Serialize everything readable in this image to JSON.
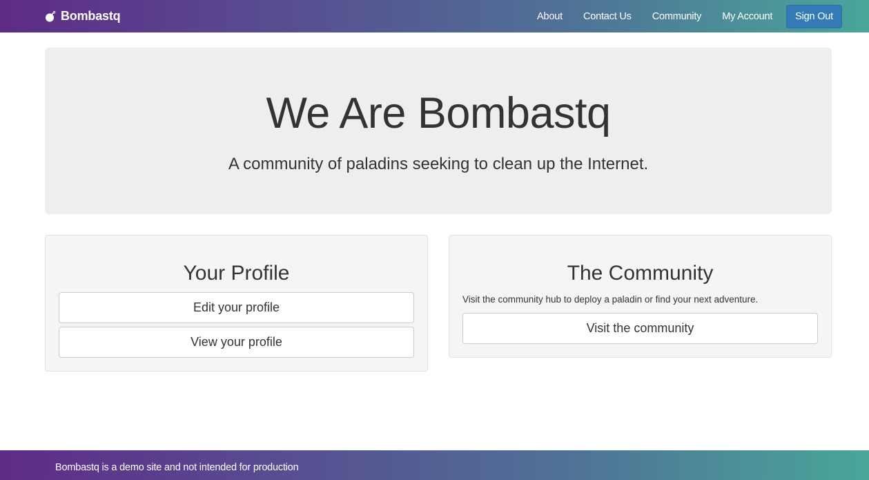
{
  "navbar": {
    "brand": "Bombastq",
    "brand_icon": "bomb-icon",
    "links": [
      {
        "label": "About"
      },
      {
        "label": "Contact Us"
      },
      {
        "label": "Community"
      },
      {
        "label": "My Account"
      }
    ],
    "signout_label": "Sign Out",
    "gradient_start": "#5e2b86",
    "gradient_end": "#49a69a",
    "button_color": "#337ab7"
  },
  "jumbotron": {
    "title": "We Are Bombastq",
    "subtitle": "A community of paladins seeking to clean up the Internet."
  },
  "profile_panel": {
    "title": "Your Profile",
    "buttons": [
      {
        "label": "Edit your profile"
      },
      {
        "label": "View your profile"
      }
    ]
  },
  "community_panel": {
    "title": "The Community",
    "text": "Visit the community hub to deploy a paladin or find your next adventure.",
    "button_label": "Visit the community"
  },
  "footer": {
    "text": "Bombastq is a demo site and not intended for production"
  }
}
